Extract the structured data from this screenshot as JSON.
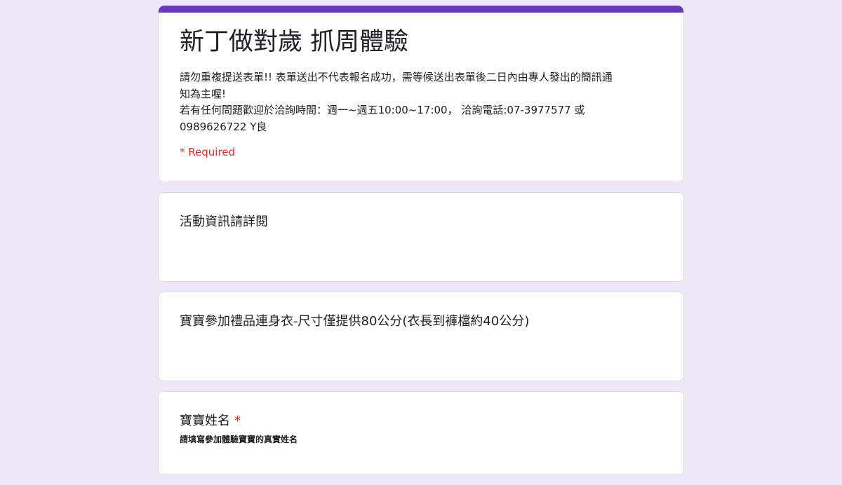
{
  "header": {
    "title": "新丁做對歲 抓周體驗",
    "description_lines": [
      "請勿重複提送表單!! 表單送出不代表報名成功，需等候送出表單後二日內由專人發出的簡訊通",
      "知為主喔!",
      "若有任何問題歡迎於洽詢時間：週一~週五10:00~17:00， 洽詢電話:07-3977577 或",
      "0989626722 Y良"
    ],
    "required_note": "* Required"
  },
  "sections": [
    {
      "title": "活動資訊請詳閱"
    },
    {
      "title": "寶寶參加禮品連身衣-尺寸僅提供80公分(衣長到褲檔約40公分)"
    }
  ],
  "question": {
    "title": "寶寶姓名",
    "required_mark": "*",
    "help_text": "請填寫參加體驗寶寶的真實姓名"
  },
  "colors": {
    "accent": "#673ab7",
    "background": "#ede7f6",
    "required": "#d93025"
  }
}
